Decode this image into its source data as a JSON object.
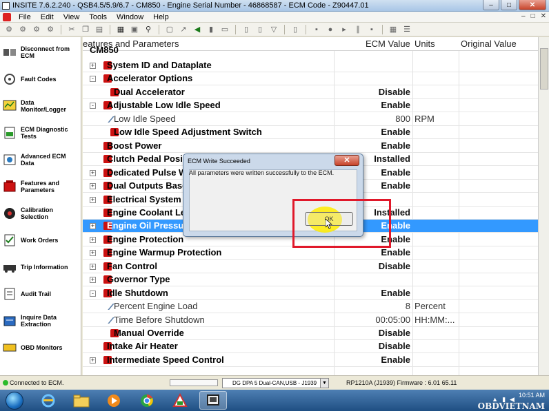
{
  "window": {
    "title": "INSITE 7.6.2.240  -  QSB4.5/5.9/6.7  -  CM850  -  Engine Serial Number  -  46868587  -  ECM Code  -  Z90447.01",
    "min_label": "–",
    "max_label": "□",
    "close_label": "✕"
  },
  "menu": {
    "items": [
      "File",
      "Edit",
      "View",
      "Tools",
      "Window",
      "Help"
    ],
    "mdi_controls": [
      "–",
      "□",
      "✕"
    ]
  },
  "sidebar": {
    "items": [
      {
        "label": "Disconnect from ECM",
        "icon": "disconnect-icon"
      },
      {
        "label": "Fault Codes",
        "icon": "fault-codes-icon"
      },
      {
        "label": "Data Monitor/Logger",
        "icon": "data-monitor-icon"
      },
      {
        "label": "ECM Diagnostic Tests",
        "icon": "diagnostic-tests-icon"
      },
      {
        "label": "Advanced ECM Data",
        "icon": "advanced-data-icon"
      },
      {
        "label": "Features and Parameters",
        "icon": "features-icon"
      },
      {
        "label": "Calibration Selection",
        "icon": "calibration-icon"
      },
      {
        "label": "Work Orders",
        "icon": "work-orders-icon"
      },
      {
        "label": "Trip Information",
        "icon": "trip-info-icon"
      },
      {
        "label": "Audit Trail",
        "icon": "audit-trail-icon"
      },
      {
        "label": "Inquire Data Extraction",
        "icon": "inquire-data-icon"
      },
      {
        "label": "OBD Monitors",
        "icon": "obd-monitors-icon"
      }
    ]
  },
  "grid": {
    "headers": {
      "name": "eatures and Parameters",
      "value": "ECM Value",
      "units": "Units",
      "original": "Original Value"
    },
    "root_label": "CM850",
    "rows": [
      {
        "name": "System ID and Dataplate",
        "value": "",
        "unit": "",
        "level": 0,
        "expander": "+",
        "icon": "folder",
        "bold": true
      },
      {
        "name": "Accelerator Options",
        "value": "",
        "unit": "",
        "level": 0,
        "expander": "-",
        "icon": "folder",
        "bold": true
      },
      {
        "name": "Dual Accelerator",
        "value": "Disable",
        "unit": "",
        "level": 1,
        "expander": "",
        "icon": "folder",
        "bold": true
      },
      {
        "name": "Adjustable Low Idle Speed",
        "value": "Enable",
        "unit": "",
        "level": 0,
        "expander": "-",
        "icon": "folder",
        "bold": true
      },
      {
        "name": "Low Idle Speed",
        "value": "800",
        "unit": "RPM",
        "level": 1,
        "expander": "",
        "icon": "param",
        "bold": false
      },
      {
        "name": "Low Idle Speed Adjustment Switch",
        "value": "Enable",
        "unit": "",
        "level": 1,
        "expander": "",
        "icon": "folder",
        "bold": true
      },
      {
        "name": "Boost Power",
        "value": "Enable",
        "unit": "",
        "level": 0,
        "expander": "",
        "icon": "folder",
        "bold": true
      },
      {
        "name": "Clutch Pedal Posi",
        "value": "Installed",
        "unit": "",
        "level": 0,
        "expander": "",
        "icon": "folder",
        "bold": true
      },
      {
        "name": "Dedicated Pulse W",
        "value": "Enable",
        "unit": "",
        "level": 0,
        "expander": "+",
        "icon": "folder",
        "bold": true
      },
      {
        "name": "Dual Outputs Base",
        "value": "Enable",
        "unit": "",
        "level": 0,
        "expander": "+",
        "icon": "folder",
        "bold": true
      },
      {
        "name": "Electrical System",
        "value": "",
        "unit": "",
        "level": 0,
        "expander": "+",
        "icon": "folder",
        "bold": true
      },
      {
        "name": "Engine Coolant Le",
        "value": "Installed",
        "unit": "",
        "level": 0,
        "expander": "",
        "icon": "folder",
        "bold": true
      },
      {
        "name": "Engine Oil Pressu",
        "value": "Enable",
        "unit": "",
        "level": 0,
        "expander": "+",
        "icon": "folder",
        "bold": true,
        "selected": true
      },
      {
        "name": "Engine Protection",
        "value": "Enable",
        "unit": "",
        "level": 0,
        "expander": "+",
        "icon": "folder",
        "bold": true
      },
      {
        "name": "Engine Warmup Protection",
        "value": "Enable",
        "unit": "",
        "level": 0,
        "expander": "+",
        "icon": "folder",
        "bold": true
      },
      {
        "name": "Fan Control",
        "value": "Disable",
        "unit": "",
        "level": 0,
        "expander": "+",
        "icon": "folder",
        "bold": true
      },
      {
        "name": "Governor Type",
        "value": "",
        "unit": "",
        "level": 0,
        "expander": "+",
        "icon": "folder",
        "bold": true
      },
      {
        "name": "Idle Shutdown",
        "value": "Enable",
        "unit": "",
        "level": 0,
        "expander": "-",
        "icon": "folder",
        "bold": true
      },
      {
        "name": "Percent Engine Load",
        "value": "8",
        "unit": "Percent",
        "level": 1,
        "expander": "",
        "icon": "param",
        "bold": false
      },
      {
        "name": "Time Before Shutdown",
        "value": "00:05:00",
        "unit": "HH:MM:...",
        "level": 1,
        "expander": "",
        "icon": "param",
        "bold": false
      },
      {
        "name": "Manual Override",
        "value": "Disable",
        "unit": "",
        "level": 1,
        "expander": "",
        "icon": "folder",
        "bold": true
      },
      {
        "name": "Intake Air Heater",
        "value": "Disable",
        "unit": "",
        "level": 0,
        "expander": "",
        "icon": "folder",
        "bold": true
      },
      {
        "name": "Intermediate Speed Control",
        "value": "Enable",
        "unit": "",
        "level": 0,
        "expander": "+",
        "icon": "folder",
        "bold": true
      }
    ]
  },
  "dialog": {
    "title": "ECM Write Succeeded",
    "message": "All parameters were written successfully to the ECM.",
    "ok_label": "OK",
    "close_label": "✕"
  },
  "status": {
    "connection": "Connected to ECM.",
    "adapter": "DG DPA 5 Dual-CAN,USB - J1939",
    "firmware": "RP1210A (J1939)  Firmware : 6.01 65.11"
  },
  "taskbar": {
    "time": "10:51 AM",
    "watermark": "OBDVIETNAM"
  },
  "colors": {
    "selection": "#3399ff",
    "highlight_box": "#e0182a",
    "highlight_circle": "#ffec00",
    "param_folder": "#cc1111"
  }
}
